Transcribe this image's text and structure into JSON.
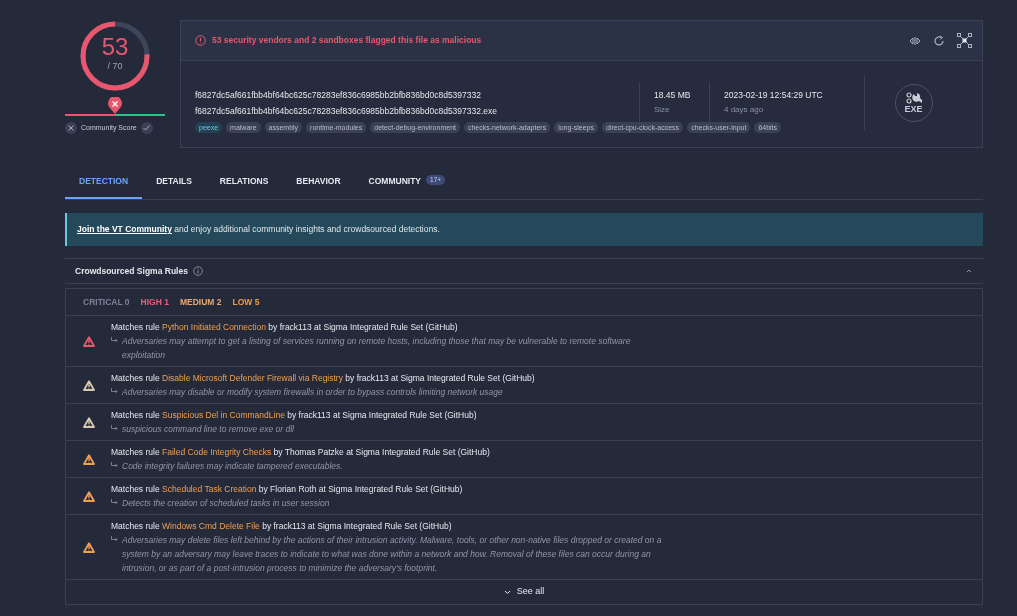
{
  "score": {
    "detections": "53",
    "total": "/ 70"
  },
  "community_score": {
    "label": "Community Score",
    "level": 0.5
  },
  "alert": "53 security vendors and 2 sandboxes flagged this file as malicious",
  "file": {
    "hash": "f6827dc5af661fbb4bf64bc625c78283ef836c6985bb2bfb836bd0c8d5397332",
    "name": "f6827dc5af661fbb4bf64bc625c78283ef836c6985bb2bfb836bd0c8d5397332.exe",
    "size": "18.45 MB",
    "size_label": "Size",
    "date": "2023-02-19 12:54:29 UTC",
    "date_label": "4 days ago",
    "type": "EXE"
  },
  "tags": [
    {
      "label": "peexe",
      "kind": "type"
    },
    {
      "label": "malware",
      "kind": "tag"
    },
    {
      "label": "assembly",
      "kind": "tag"
    },
    {
      "label": "runtime-modules",
      "kind": "tag"
    },
    {
      "label": "detect-debug-environment",
      "kind": "tag"
    },
    {
      "label": "checks-network-adapters",
      "kind": "tag"
    },
    {
      "label": "long-sleeps",
      "kind": "tag"
    },
    {
      "label": "direct-cpu-clock-access",
      "kind": "tag"
    },
    {
      "label": "checks-user-input",
      "kind": "tag"
    },
    {
      "label": "64bits",
      "kind": "tag"
    }
  ],
  "tabs": [
    {
      "label": "DETECTION",
      "selected": true
    },
    {
      "label": "DETAILS",
      "selected": false
    },
    {
      "label": "RELATIONS",
      "selected": false
    },
    {
      "label": "BEHAVIOR",
      "selected": false
    },
    {
      "label": "COMMUNITY",
      "selected": false,
      "badge": "17+"
    }
  ],
  "banner": {
    "link": "Join the VT Community",
    "text": " and enjoy additional community insights and crowdsourced detections."
  },
  "sigma": {
    "title": "Crowdsourced Sigma Rules",
    "filters": [
      {
        "label": "CRITICAL 0",
        "kind": "critical"
      },
      {
        "label": "HIGH 1",
        "kind": "high"
      },
      {
        "label": "MEDIUM 2",
        "kind": "medium"
      },
      {
        "label": "LOW 5",
        "kind": "low"
      }
    ],
    "rules": [
      {
        "color": "#e8576d",
        "prefix": "Matches rule ",
        "name": "Python Initiated Connection",
        "suffix": " by frack113 at Sigma Integrated Rule Set (GitHub)",
        "description": "Adversaries may attempt to get a listing of services running on remote hosts, including those that may be vulnerable to remote software exploitation"
      },
      {
        "color": "#d8c8b0",
        "prefix": "Matches rule ",
        "name": "Disable Microsoft Defender Firewall via Registry",
        "suffix": " by frack113 at Sigma Integrated Rule Set (GitHub)",
        "description": "Adversaries may disable or modify system firewalls in order to bypass controls limiting network usage"
      },
      {
        "color": "#d8c8b0",
        "prefix": "Matches rule ",
        "name": "Suspicious Del in CommandLine",
        "suffix": " by frack113 at Sigma Integrated Rule Set (GitHub)",
        "description": "suspicious command line to remove exe or dll"
      },
      {
        "color": "#ef9f52",
        "prefix": "Matches rule ",
        "name": "Failed Code Integrity Checks",
        "suffix": " by Thomas Patzke at Sigma Integrated Rule Set (GitHub)",
        "description": "Code integrity failures may indicate tampered executables."
      },
      {
        "color": "#ef9f52",
        "prefix": "Matches rule ",
        "name": "Scheduled Task Creation",
        "suffix": " by Florian Roth at Sigma Integrated Rule Set (GitHub)",
        "description": "Detects the creation of scheduled tasks in user session"
      },
      {
        "color": "#ef9f52",
        "prefix": "Matches rule ",
        "name": "Windows Cmd Delete File",
        "suffix": " by frack113 at Sigma Integrated Rule Set (GitHub)",
        "description": "Adversaries may delete files left behind by the actions of their intrusion activity. Malware, tools, or other non-native files dropped or created on a system by an adversary may leave traces to indicate to what was done within a network and how. Removal of these files can occur during an intrusion, or as part of a post-intrusion process to minimize the adversary's footprint."
      }
    ],
    "see_all": "See all"
  }
}
